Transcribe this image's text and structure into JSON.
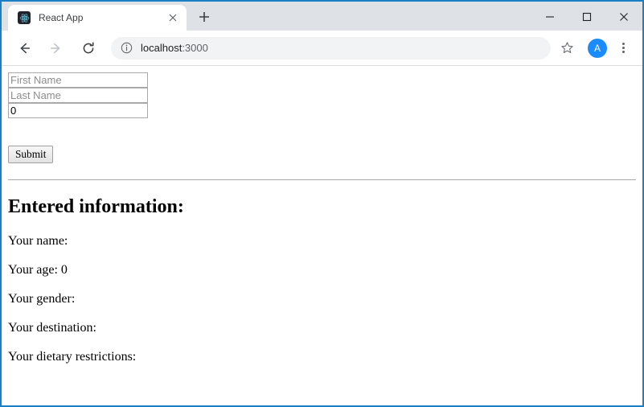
{
  "window": {
    "controls": {
      "minimize": "—",
      "maximize": "□",
      "close": "✕"
    },
    "accent_color": "#1a7fc4",
    "titlebar_color": "#dee1e6"
  },
  "tabs": {
    "active": {
      "title": "React App",
      "favicon_name": "react-logo-icon",
      "close_label": "✕"
    },
    "new_tab_label": "+"
  },
  "toolbar": {
    "back_label": "←",
    "forward_label": "→",
    "reload_label": "⟳",
    "url_host": "localhost",
    "url_port": ":3000",
    "url_full": "localhost:3000",
    "site_info_icon": "info-circle-icon",
    "bookmark_icon": "star-outline-icon",
    "profile_initial": "A",
    "profile_color": "#1a8cff",
    "menu_icon": "three-dots-vertical-icon"
  },
  "form": {
    "first_name": {
      "placeholder": "First Name",
      "value": ""
    },
    "last_name": {
      "placeholder": "Last Name",
      "value": ""
    },
    "age": {
      "placeholder": "",
      "value": "0"
    },
    "submit_label": "Submit"
  },
  "results": {
    "heading": "Entered information:",
    "lines": [
      "Your name:",
      "Your age: 0",
      "Your gender:",
      "Your destination:",
      "Your dietary restrictions:"
    ]
  }
}
